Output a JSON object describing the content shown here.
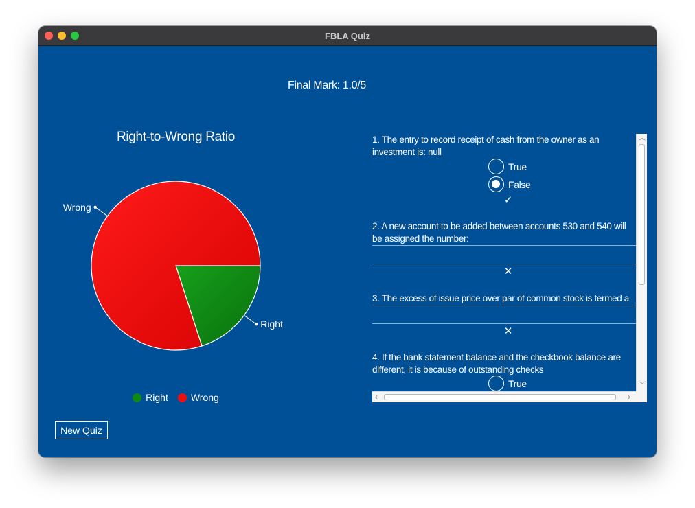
{
  "window": {
    "title": "FBLA Quiz"
  },
  "result": {
    "final_mark": "Final Mark: 1.0/5"
  },
  "chart_data": {
    "type": "pie",
    "title": "Right-to-Wrong Ratio",
    "slices": [
      {
        "label": "Right",
        "value": 1,
        "color": "#0e8a12"
      },
      {
        "label": "Wrong",
        "value": 4,
        "color": "#ec1010"
      }
    ],
    "legend": [
      "Right",
      "Wrong"
    ],
    "legend_position": "bottom"
  },
  "legend": {
    "right_label": "Right",
    "wrong_label": "Wrong"
  },
  "buttons": {
    "new_quiz": "New Quiz"
  },
  "questions": [
    {
      "line1": "1. The entry to record receipt of cash from the owner as an",
      "line2": "investment is: null",
      "options": [
        "True",
        "False"
      ],
      "selected": "False",
      "mark": "✓"
    },
    {
      "line1": "2. A new account to be added between accounts 530 and 540 will",
      "line2": "be assigned the number:",
      "answer": "",
      "mark": "✕"
    },
    {
      "line1": "3. The excess of issue price over par of common stock is termed a",
      "answer": "",
      "mark": "✕"
    },
    {
      "line1": "4. If the bank statement balance and the checkbook balance are",
      "line2": "different, it is because of outstanding checks",
      "options": [
        "True"
      ]
    }
  ],
  "icons": {
    "check": "check-icon",
    "cross": "cross-icon",
    "scroll_up": "chevron-up-icon",
    "scroll_down": "chevron-down-icon",
    "scroll_left": "chevron-left-icon",
    "scroll_right": "chevron-right-icon"
  }
}
